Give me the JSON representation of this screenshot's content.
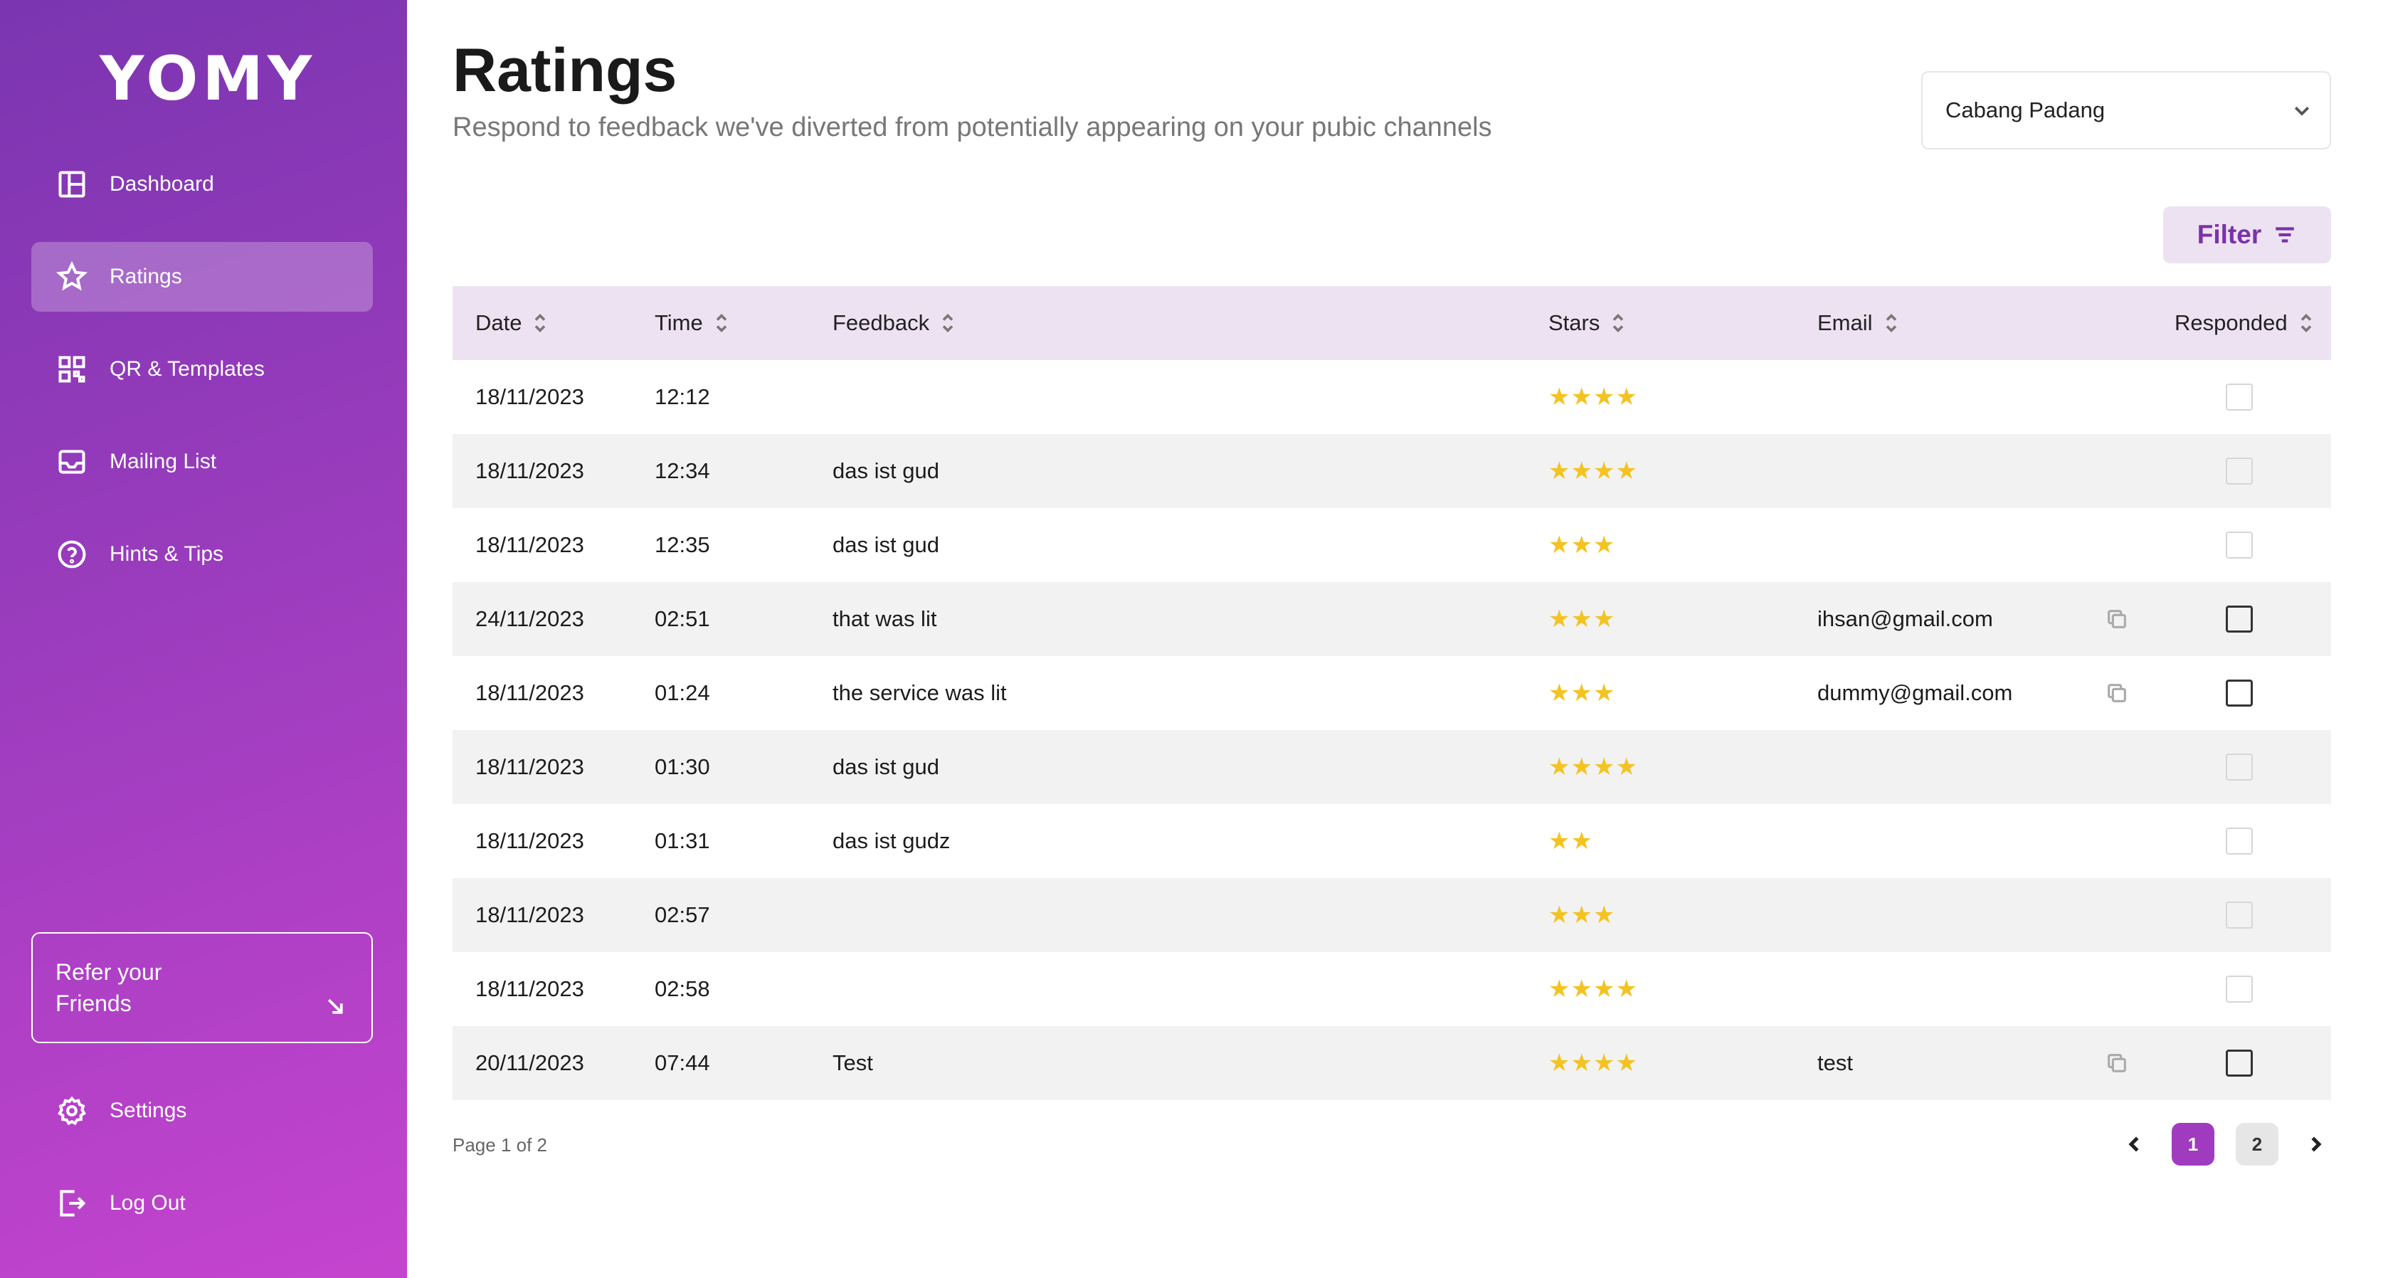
{
  "brand": {
    "logo_text": "YOMY",
    "accent": "#a03bc0",
    "sidebar_gradient": [
      "#7b35b0",
      "#c544cf"
    ],
    "star_color": "#f3c322"
  },
  "sidebar": {
    "items": [
      {
        "label": "Dashboard",
        "icon": "layout-icon"
      },
      {
        "label": "Ratings",
        "icon": "star-icon",
        "active": true
      },
      {
        "label": "QR & Templates",
        "icon": "qr-icon"
      },
      {
        "label": "Mailing List",
        "icon": "inbox-icon"
      },
      {
        "label": "Hints & Tips",
        "icon": "help-circle-icon"
      }
    ],
    "refer": {
      "line1": "Refer your",
      "line2": "Friends",
      "icon": "arrow-down-right-icon"
    },
    "bottom_items": [
      {
        "label": "Settings",
        "icon": "gear-icon"
      },
      {
        "label": "Log Out",
        "icon": "logout-icon"
      }
    ]
  },
  "header": {
    "title": "Ratings",
    "subtitle": "Respond to feedback we've diverted from potentially appearing on your pubic channels",
    "branch_select": {
      "value": "Cabang Padang"
    },
    "filter_label": "Filter"
  },
  "table": {
    "columns": [
      "Date",
      "Time",
      "Feedback",
      "Stars",
      "Email",
      "Responded"
    ],
    "rows": [
      {
        "date": "18/11/2023",
        "time": "12:12",
        "feedback": "",
        "stars": 4,
        "email": "",
        "responded_enabled": false
      },
      {
        "date": "18/11/2023",
        "time": "12:34",
        "feedback": "das ist gud",
        "stars": 4,
        "email": "",
        "responded_enabled": false
      },
      {
        "date": "18/11/2023",
        "time": "12:35",
        "feedback": "das ist gud",
        "stars": 3,
        "email": "",
        "responded_enabled": false
      },
      {
        "date": "24/11/2023",
        "time": "02:51",
        "feedback": "that was lit",
        "stars": 3,
        "email": "ihsan@gmail.com",
        "responded_enabled": true
      },
      {
        "date": "18/11/2023",
        "time": "01:24",
        "feedback": "the service was lit",
        "stars": 3,
        "email": "dummy@gmail.com",
        "responded_enabled": true
      },
      {
        "date": "18/11/2023",
        "time": "01:30",
        "feedback": "das ist gud",
        "stars": 4,
        "email": "",
        "responded_enabled": false
      },
      {
        "date": "18/11/2023",
        "time": "01:31",
        "feedback": "das ist gudz",
        "stars": 2,
        "email": "",
        "responded_enabled": false
      },
      {
        "date": "18/11/2023",
        "time": "02:57",
        "feedback": "",
        "stars": 3,
        "email": "",
        "responded_enabled": false
      },
      {
        "date": "18/11/2023",
        "time": "02:58",
        "feedback": "",
        "stars": 4,
        "email": "",
        "responded_enabled": false
      },
      {
        "date": "20/11/2023",
        "time": "07:44",
        "feedback": "Test",
        "stars": 4,
        "email": "test",
        "responded_enabled": true
      }
    ]
  },
  "pagination": {
    "info": "Page 1 of 2",
    "pages": [
      "1",
      "2"
    ],
    "current": "1"
  }
}
